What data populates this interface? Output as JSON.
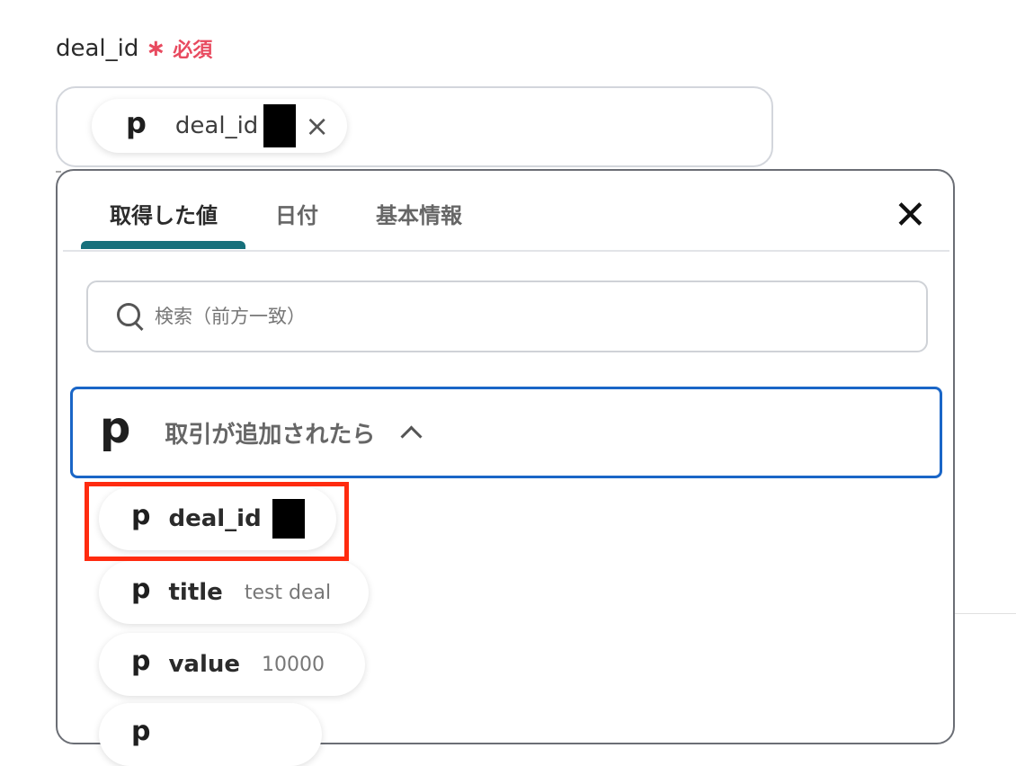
{
  "field": {
    "label": "deal_id",
    "required_mark": "∗",
    "required_text": "必須"
  },
  "selected_chip": {
    "logo": "p",
    "label": "deal_id",
    "close_icon": "×"
  },
  "panel": {
    "tabs": [
      {
        "label": "取得した値",
        "active": true
      },
      {
        "label": "日付",
        "active": false
      },
      {
        "label": "基本情報",
        "active": false
      }
    ],
    "close_icon": "✕",
    "search": {
      "placeholder": "検索（前方一致）",
      "value": ""
    },
    "group": {
      "logo": "p",
      "title": "取引が追加されたら",
      "expanded": true
    },
    "items": [
      {
        "logo": "p",
        "key": "deal_id",
        "value": ""
      },
      {
        "logo": "p",
        "key": "title",
        "value": "test deal"
      },
      {
        "logo": "p",
        "key": "value",
        "value": "10000"
      },
      {
        "logo": "p",
        "key": "",
        "value": ""
      }
    ]
  },
  "colors": {
    "required": "#e84a5f",
    "tab_active_underline": "#16707b",
    "group_border": "#1a66c7",
    "highlight": "#ff2b0f"
  }
}
